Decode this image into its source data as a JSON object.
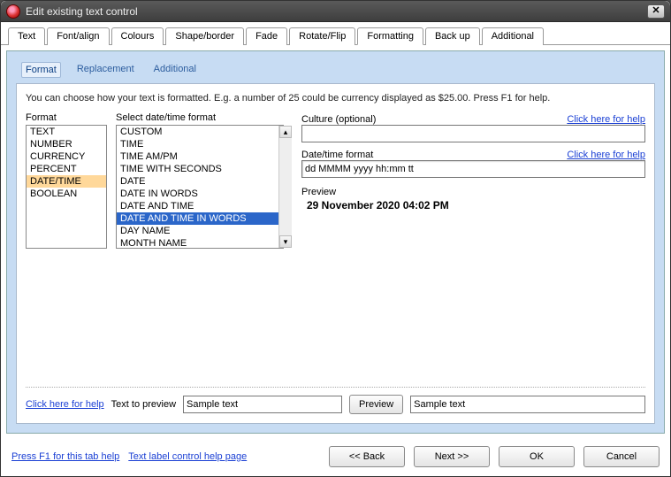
{
  "window": {
    "title": "Edit existing text control",
    "close": "✕"
  },
  "outerTabs": [
    "Text",
    "Font/align",
    "Colours",
    "Shape/border",
    "Fade",
    "Rotate/Flip",
    "Formatting",
    "Back up",
    "Additional"
  ],
  "outerActive": 6,
  "innerTabs": [
    "Format",
    "Replacement",
    "Additional"
  ],
  "innerActive": 0,
  "intro": "You can choose how your text is formatted.  E.g. a number of 25 could be currency displayed as $25.00.  Press F1 for help.",
  "labels": {
    "format": "Format",
    "selectDt": "Select date/time format",
    "culture": "Culture (optional)",
    "dtf": "Date/time format",
    "preview": "Preview",
    "helpLink": "Click here for help",
    "textToPreview": "Text to preview",
    "previewBtn": "Preview"
  },
  "formatItems": [
    "TEXT",
    "NUMBER",
    "CURRENCY",
    "PERCENT",
    "DATE/TIME",
    "BOOLEAN"
  ],
  "formatSelected": 4,
  "dtItems": [
    "CUSTOM",
    "TIME",
    "TIME AM/PM",
    "TIME WITH SECONDS",
    "DATE",
    "DATE IN WORDS",
    "DATE AND TIME",
    "DATE AND TIME IN WORDS",
    "DAY NAME",
    "MONTH NAME"
  ],
  "dtSelected": 7,
  "fields": {
    "culture": "",
    "dtf": "dd MMMM yyyy hh:mm tt",
    "previewValue": "29 November 2020 04:02 PM",
    "sample": "Sample text",
    "sampleOut": "Sample text"
  },
  "footer": {
    "tabHelp": "Press F1 for this tab help",
    "controlHelp": "Text label control help page",
    "back": "<< Back",
    "next": "Next >>",
    "ok": "OK",
    "cancel": "Cancel"
  }
}
